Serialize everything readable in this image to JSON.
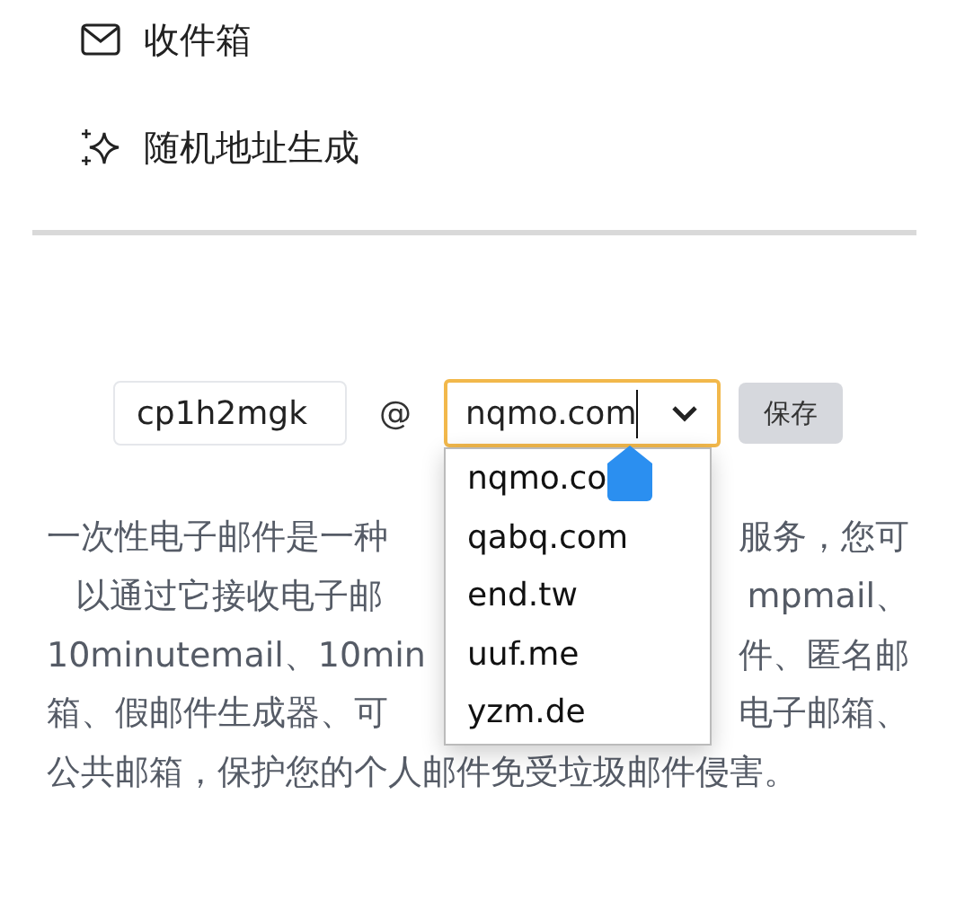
{
  "menu": [
    {
      "kind": "inbox",
      "label": "收件箱"
    },
    {
      "kind": "random",
      "label": "随机地址生成"
    }
  ],
  "address_form": {
    "username": "cp1h2mgk",
    "at": "@",
    "domain": "nqmo.com",
    "focused": true,
    "save_button": "保存"
  },
  "domain_options": [
    "nqmo.co",
    "qabq.com",
    "end.tw",
    "uuf.me",
    "yzm.de"
  ],
  "description_lines": [
    {
      "left": "一次性电子邮件是一种",
      "right": "服务，您可",
      "indent": false
    },
    {
      "left": "以通过它接收电子邮",
      "right": "mpmail、",
      "indent": true
    },
    {
      "left": "10minutemail、10min",
      "right": "件、匿名邮",
      "indent": false
    },
    {
      "left": "箱、假邮件生成器、可",
      "right": "电子邮箱、",
      "indent": false
    },
    {
      "left": "公共邮箱，保护您的个人邮件免受垃圾邮件侵害。",
      "indent": false
    }
  ]
}
